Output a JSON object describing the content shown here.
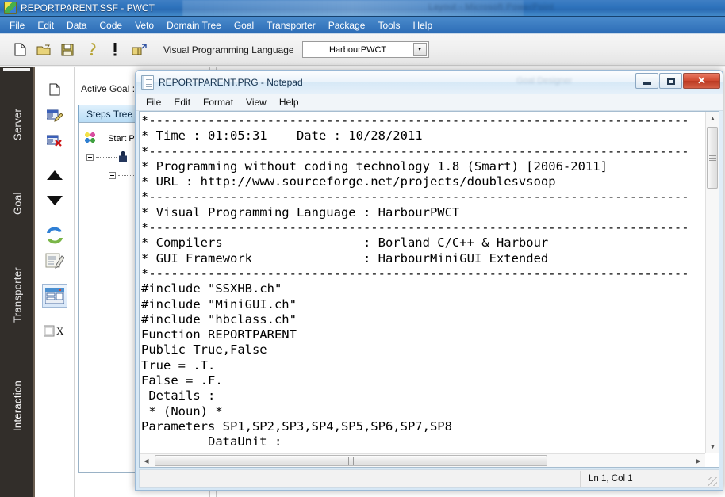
{
  "pwct": {
    "title": "REPORTPARENT.SSF  - PWCT",
    "ghost_title": "Layout - Microsoft PowerPoint",
    "menu": [
      "File",
      "Edit",
      "Data",
      "Code",
      "Veto",
      "Domain Tree",
      "Goal",
      "Transporter",
      "Package",
      "Tools",
      "Help"
    ],
    "toolbar": {
      "icons": [
        "new-file-icon",
        "open-folder-icon",
        "save-icon",
        "help-key-icon",
        "run-exclamation-icon",
        "open-project-icon"
      ],
      "glyphs": [
        "὜B",
        "Ὄ2",
        "ὋE",
        "⌥",
        "!",
        "὜1"
      ],
      "language_label": "Visual Programming Language",
      "language_value": "HarbourPWCT"
    },
    "vtabs": [
      "Server",
      "Goal",
      "Transporter",
      "Interaction"
    ],
    "selected_vtab": "Interaction",
    "icon_column": [
      "new-step-icon",
      "edit-step-icon",
      "delete-step-icon",
      "move-up-icon",
      "move-down-icon",
      "refresh-icon",
      "notes-icon",
      "properties-icon",
      "close-x-icon"
    ],
    "explorer": {
      "active_goal_label": "Active Goal :",
      "steps_tree_tab": "Steps Tree",
      "tree_root": "Start P"
    }
  },
  "notepad": {
    "title": "REPORTPARENT.PRG - Notepad",
    "ghost_title": "Goal Designer",
    "menu": [
      "File",
      "Edit",
      "Format",
      "View",
      "Help"
    ],
    "window_buttons": {
      "minimize": "minimize-button",
      "maximize": "maximize-button",
      "close": "✕"
    },
    "content": "*-------------------------------------------------------------------------\n* Time : 01:05:31    Date : 10/28/2011\n*-------------------------------------------------------------------------\n* Programming without coding technology 1.8 (Smart) [2006-2011]\n* URL : http://www.sourceforge.net/projects/doublesvsoop\n*-------------------------------------------------------------------------\n* Visual Programming Language : HarbourPWCT\n*-------------------------------------------------------------------------\n* Compilers                   : Borland C/C++ & Harbour\n* GUI Framework               : HarbourMiniGUI Extended\n*-------------------------------------------------------------------------\n#include \"SSXHB.ch\"\n#include \"MiniGUI.ch\"\n#include \"hbclass.ch\"\nFunction REPORTPARENT\nPublic True,False\nTrue = .T.\nFalse = .F.\n Details :\n * (Noun) *\nParameters SP1,SP2,SP3,SP4,SP5,SP6,SP7,SP8\n         DataUnit :",
    "status": "Ln 1, Col 1"
  },
  "colors": {
    "titlebar_blue": "#2f74bd",
    "menubar_blue": "#3a7cc0",
    "sidebar_dark": "#322e2a",
    "close_red": "#d04b32",
    "tab_blue": "#b9ddf6"
  }
}
